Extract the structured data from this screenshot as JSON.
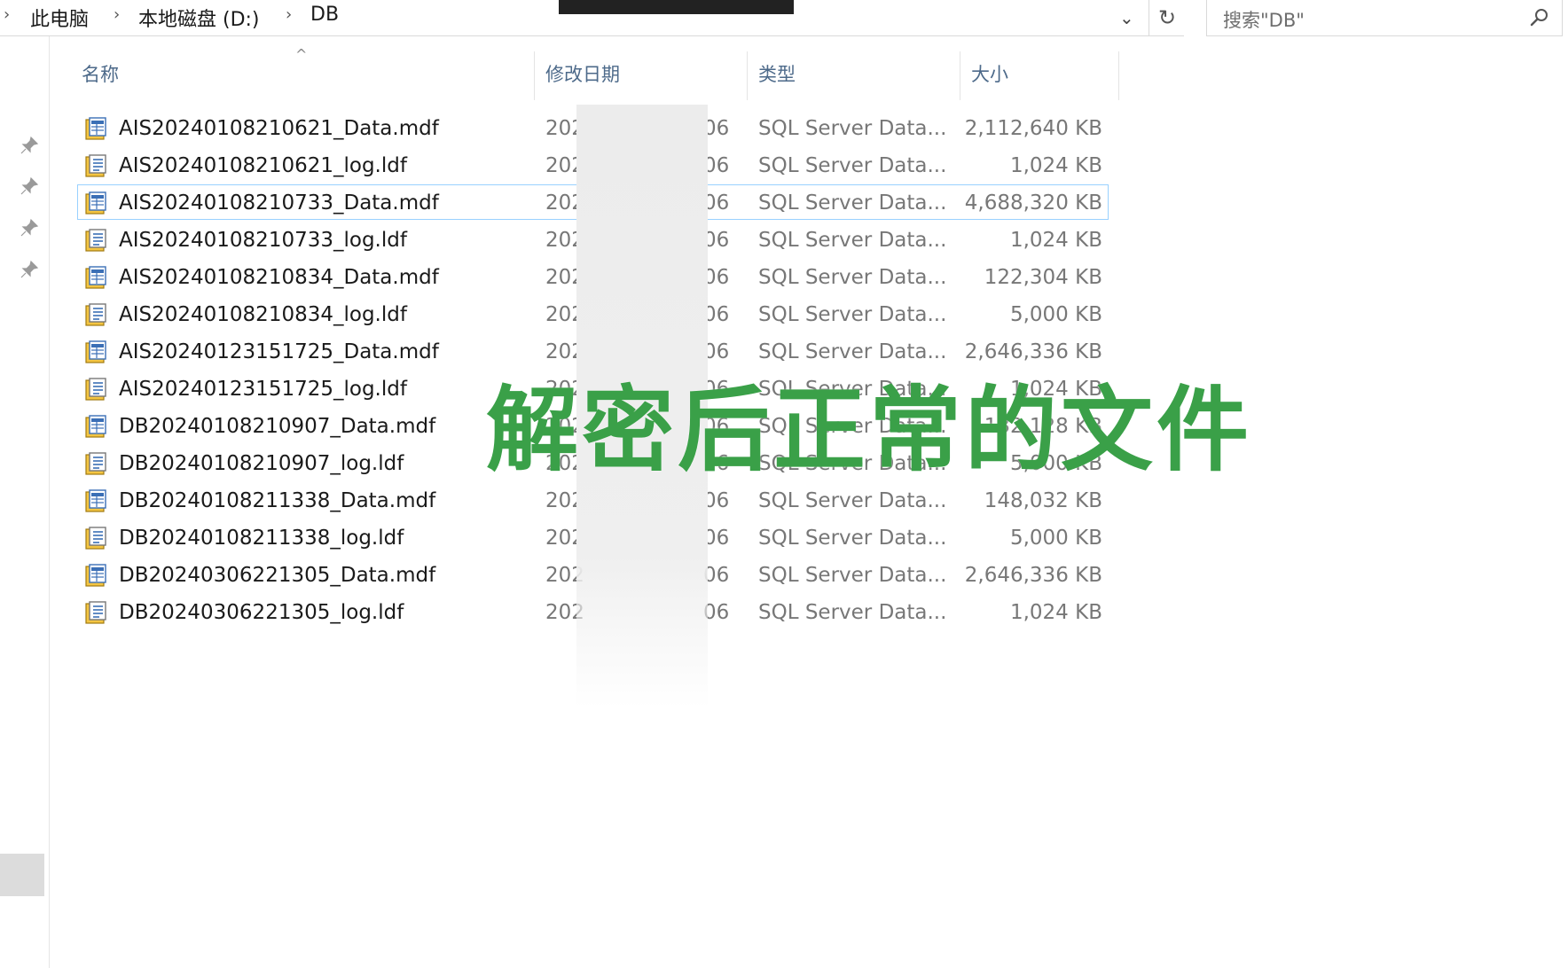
{
  "breadcrumb": {
    "items": [
      "此电脑",
      "本地磁盘 (D:)",
      "DB"
    ]
  },
  "search": {
    "placeholder": "搜索\"DB\""
  },
  "columns": {
    "name": "名称",
    "modified": "修改日期",
    "type": "类型",
    "size": "大小"
  },
  "files": [
    {
      "name": "AIS20240108210621_Data.mdf",
      "date_start": "202",
      "date_end": "06",
      "type": "SQL Server Data...",
      "size": "2,112,640 KB",
      "kind": "mdf"
    },
    {
      "name": "AIS20240108210621_log.ldf",
      "date_start": "202",
      "date_end": "06",
      "type": "SQL Server Data...",
      "size": "1,024 KB",
      "kind": "ldf"
    },
    {
      "name": "AIS20240108210733_Data.mdf",
      "date_start": "202",
      "date_end": "06",
      "type": "SQL Server Data...",
      "size": "4,688,320 KB",
      "kind": "mdf"
    },
    {
      "name": "AIS20240108210733_log.ldf",
      "date_start": "202",
      "date_end": "06",
      "type": "SQL Server Data...",
      "size": "1,024 KB",
      "kind": "ldf"
    },
    {
      "name": "AIS20240108210834_Data.mdf",
      "date_start": "202",
      "date_end": "06",
      "type": "SQL Server Data...",
      "size": "122,304 KB",
      "kind": "mdf"
    },
    {
      "name": "AIS20240108210834_log.ldf",
      "date_start": "202",
      "date_end": "06",
      "type": "SQL Server Data...",
      "size": "5,000 KB",
      "kind": "ldf"
    },
    {
      "name": "AIS20240123151725_Data.mdf",
      "date_start": "202",
      "date_end": "06",
      "type": "SQL Server Data...",
      "size": "2,646,336 KB",
      "kind": "mdf"
    },
    {
      "name": "AIS20240123151725_log.ldf",
      "date_start": "202",
      "date_end": "06",
      "type": "SQL Server Data...",
      "size": "1,024 KB",
      "kind": "ldf"
    },
    {
      "name": "DB20240108210907_Data.mdf",
      "date_start": "202",
      "date_end": "06",
      "type": "SQL Server Data...",
      "size": "132,128 KB",
      "kind": "mdf"
    },
    {
      "name": "DB20240108210907_log.ldf",
      "date_start": "202",
      "date_end": "06",
      "type": "SQL Server Data...",
      "size": "5,000 KB",
      "kind": "ldf"
    },
    {
      "name": "DB20240108211338_Data.mdf",
      "date_start": "202",
      "date_end": "06",
      "type": "SQL Server Data...",
      "size": "148,032 KB",
      "kind": "mdf"
    },
    {
      "name": "DB20240108211338_log.ldf",
      "date_start": "202",
      "date_end": "06",
      "type": "SQL Server Data...",
      "size": "5,000 KB",
      "kind": "ldf"
    },
    {
      "name": "DB20240306221305_Data.mdf",
      "date_start": "202",
      "date_end": "06",
      "type": "SQL Server Data...",
      "size": "2,646,336 KB",
      "kind": "mdf"
    },
    {
      "name": "DB20240306221305_log.ldf",
      "date_start": "202",
      "date_end": "06",
      "type": "SQL Server Data...",
      "size": "1,024 KB",
      "kind": "ldf"
    }
  ],
  "selected_index": 2,
  "overlay_caption": "解密后正常的文件",
  "colors": {
    "caption": "#3aa048",
    "header_text": "#4d6a8a",
    "selection_border": "#99d1ff"
  }
}
